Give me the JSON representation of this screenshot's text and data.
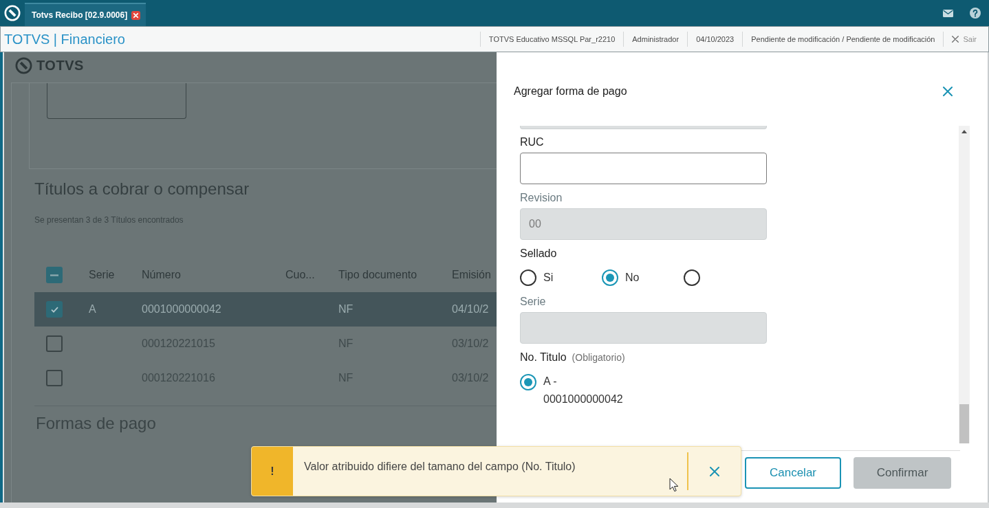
{
  "title_bar": {
    "tab": {
      "label": "Totvs Recibo [02.9.0006]",
      "selected": true
    }
  },
  "header": {
    "app_title": "TOTVS | Financiero",
    "info": [
      "TOTVS Educativo MSSQL Par_r2210",
      "Administrador",
      "04/10/2023",
      "Pendiente de modificación / Pendiente de modificación"
    ],
    "exit_label": "Sair"
  },
  "page": {
    "logo_text": "TOTVS",
    "section_title": "Títulos a cobrar o compensar",
    "result_count": "Se presentan 3 de 3 Títulos encontrados",
    "table": {
      "select_all": {
        "indeterminate": true
      },
      "columns": [
        "Serie",
        "Número",
        "Cuo...",
        "Tipo documento",
        "Emisión"
      ],
      "rows": [
        {
          "selected": true,
          "checked": true,
          "serie": "A",
          "numero": "0001000000042",
          "tipo_documento": "NF",
          "emision": "04/10/2"
        },
        {
          "selected": false,
          "checked": false,
          "numero": "000120221015",
          "tipo_documento": "NF",
          "emision": "03/10/2"
        },
        {
          "selected": false,
          "checked": false,
          "numero": "000120221016",
          "tipo_documento": "NF",
          "emision": "03/10/2"
        }
      ]
    },
    "payment_title": "Formas de pago"
  },
  "dialog": {
    "title": "Agregar forma de pago",
    "fields": [
      {
        "kind": "text",
        "disabled": true,
        "clipped": true
      },
      {
        "kind": "text",
        "label": "RUC",
        "disabled": false
      },
      {
        "kind": "text",
        "label": "Revision",
        "value": "00",
        "disabled": true
      },
      {
        "kind": "radio",
        "label": "Sellado",
        "options": [
          {
            "label": "Si",
            "selected": false
          },
          {
            "label": "No",
            "selected": true
          },
          {
            "selected": false
          }
        ]
      },
      {
        "kind": "text",
        "label": "Serie",
        "disabled": true
      },
      {
        "kind": "radio",
        "label": "No. Titulo",
        "hint": "(Obligatorio)",
        "options": [
          {
            "label": "A - 0001000000042",
            "selected": true
          }
        ]
      }
    ],
    "buttons": [
      {
        "label": "Cancelar",
        "kind": "secondary",
        "disabled": false
      },
      {
        "label": "Confirmar",
        "kind": "primary",
        "disabled": true
      }
    ]
  },
  "toast": {
    "kind": "warning",
    "marker": "!",
    "message": "Valor atribuido difiere del tamano del campo (No. Titulo)"
  }
}
